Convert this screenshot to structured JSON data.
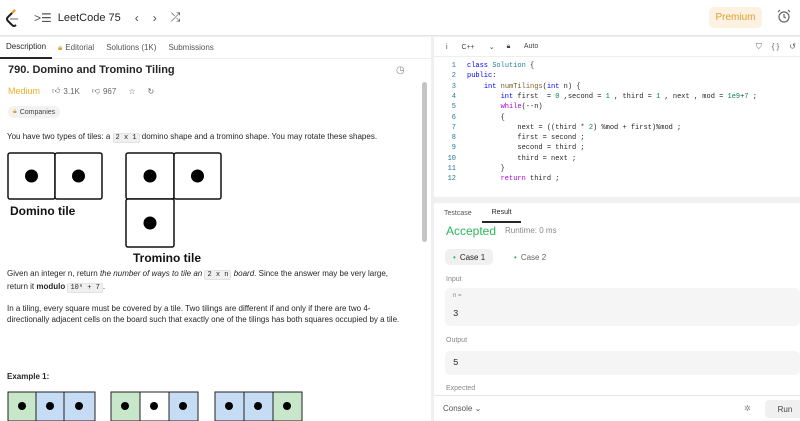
{
  "topbar": {
    "title": "LeetCode 75",
    "prev_icon": "chevron-left-icon",
    "next_icon": "chevron-right-icon",
    "shuffle_icon": "shuffle-icon",
    "premium_label": "Premium",
    "accent": "#ffa116"
  },
  "tabs": [
    {
      "label": "Description",
      "active": true
    },
    {
      "label": "Editorial",
      "active": false
    },
    {
      "label": "Solutions (1K)",
      "active": false
    },
    {
      "label": "Submissions",
      "active": false
    }
  ],
  "problem": {
    "title": "790. Domino and Tromino Tiling",
    "difficulty": "Medium",
    "likes": "3.1K",
    "dislikes": "967",
    "companies_label": "Companies",
    "intro_a": "You have two types of tiles: a ",
    "intro_code": "2 x 1",
    "intro_b": " domino shape and a tromino shape. You may rotate these shapes.",
    "domino_label": "Domino tile",
    "tromino_label": "Tromino tile",
    "given_a": "Given an integer n, return ",
    "given_i1": "the number of ways to tile an ",
    "given_code": "2 x n",
    "given_i2": " board",
    "given_b": ". Since the answer may be very large,",
    "return_a": "return it ",
    "modulo": "modulo",
    "mod_code": "10⁹ + 7",
    "return_end": ".",
    "tiling_text": "In a tiling, every square must be covered by a tile. Two tilings are different if and only if there are two 4-directionally adjacent cells on the board such that exactly one of the tilings has both squares occupied by a tile.",
    "example_label": "Example 1:"
  },
  "editor": {
    "language": "C++",
    "mode": "Auto",
    "lines": [
      "1",
      "2",
      "3",
      "4",
      "5",
      "6",
      "7",
      "8",
      "9",
      "10",
      "11",
      "12"
    ]
  },
  "result": {
    "tab_testcase": "Testcase",
    "tab_result": "Result",
    "status": "Accepted",
    "runtime": "Runtime: 0 ms",
    "case1": "Case 1",
    "case2": "Case 2",
    "input_label": "Input",
    "input_key": "n =",
    "input_value": "3",
    "output_label": "Output",
    "output_value": "5",
    "expected_label": "Expected",
    "console_label": "Console",
    "run_label": "Run",
    "accepted_color": "#2db55d"
  }
}
